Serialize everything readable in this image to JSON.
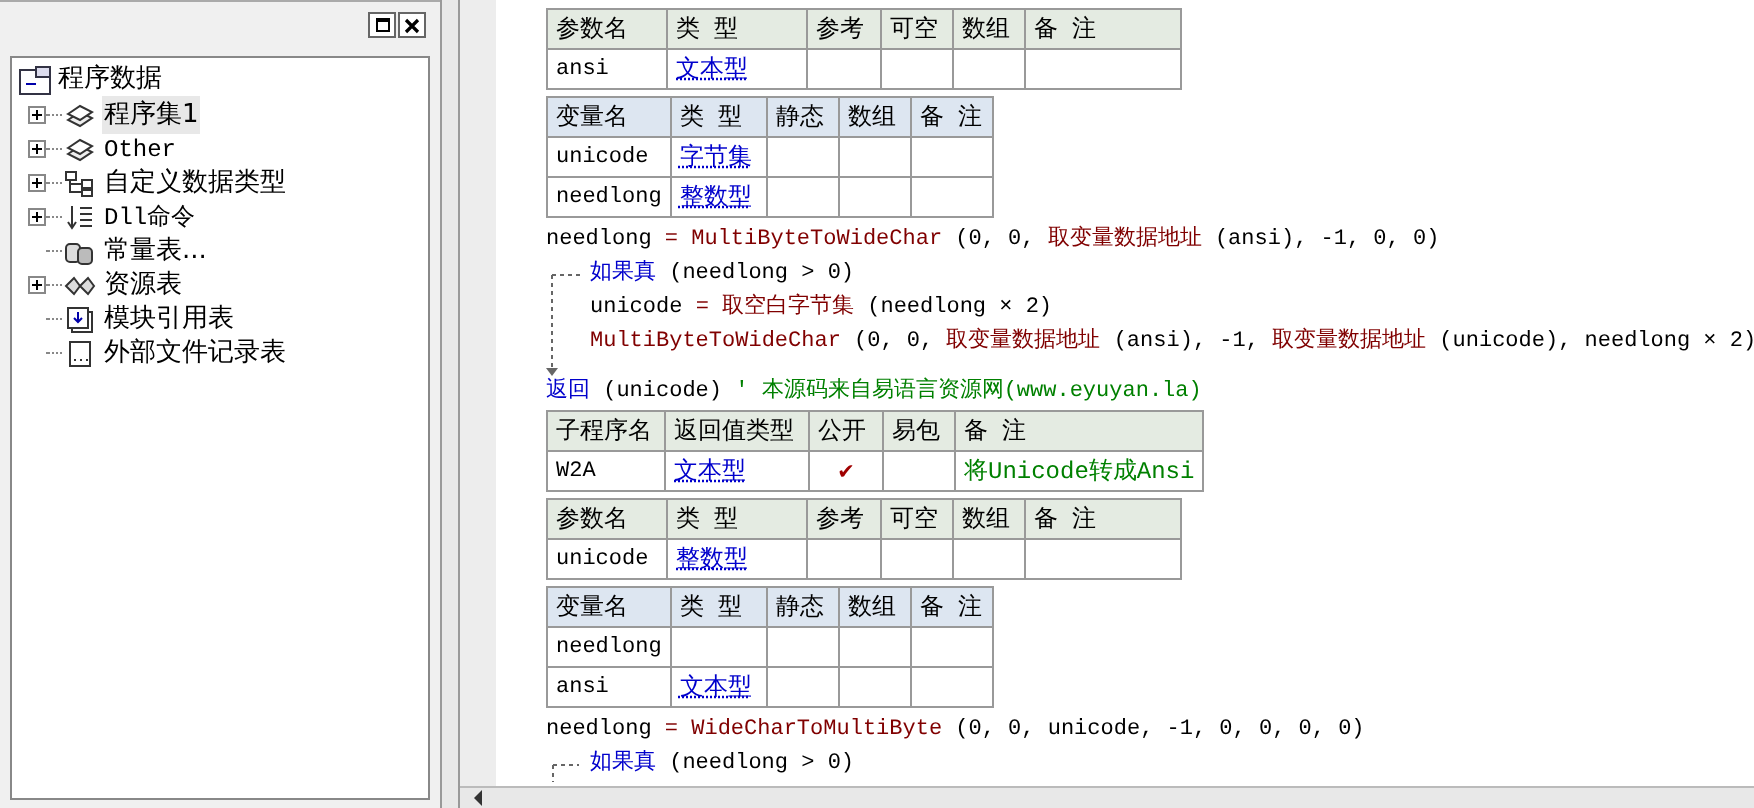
{
  "tree": {
    "root": "程序数据",
    "items": [
      {
        "label": "程序集1",
        "expandable": true,
        "selected": true
      },
      {
        "label": "Other",
        "expandable": true,
        "selected": false
      },
      {
        "label": "自定义数据类型",
        "expandable": true,
        "selected": false
      },
      {
        "label": "Dll命令",
        "expandable": true,
        "selected": false
      },
      {
        "label": "常量表...",
        "expandable": false,
        "selected": false
      },
      {
        "label": "资源表",
        "expandable": true,
        "selected": false
      },
      {
        "label": "模块引用表",
        "expandable": false,
        "selected": false
      },
      {
        "label": "外部文件记录表",
        "expandable": false,
        "selected": false
      }
    ]
  },
  "code": [
    {
      "kind": "param_table",
      "header": [
        "参数名",
        "类 型",
        "参考",
        "可空",
        "数组",
        "备 注"
      ],
      "rows": [
        [
          "ansi",
          "文本型",
          "",
          "",
          "",
          ""
        ]
      ]
    },
    {
      "kind": "var_table",
      "header": [
        "变量名",
        "类 型",
        "静态",
        "数组",
        "备 注"
      ],
      "rows": [
        [
          "unicode",
          "字节集",
          "",
          "",
          ""
        ],
        [
          "needlong",
          "整数型",
          "",
          "",
          ""
        ]
      ]
    },
    {
      "kind": "line",
      "tokens": [
        {
          "kind": "text",
          "text": "needlong "
        },
        {
          "kind": "func",
          "text": "= MultiByteToWideChar"
        },
        {
          "kind": "text",
          "text": " (0, 0, "
        },
        {
          "kind": "func",
          "text": "取变量数据地址"
        },
        {
          "kind": "text",
          "text": " (ansi), -1, 0, 0)"
        }
      ]
    },
    {
      "kind": "if",
      "condition": [
        {
          "kind": "keyword",
          "text": "如果真"
        },
        {
          "kind": "text",
          "text": " (needlong > 0)"
        }
      ],
      "children": [
        {
          "kind": "line",
          "tokens": [
            {
              "kind": "text",
              "text": "unicode "
            },
            {
              "kind": "func",
              "text": "= 取空白字节集"
            },
            {
              "kind": "text",
              "text": " (needlong × 2)"
            }
          ]
        },
        {
          "kind": "line",
          "tokens": [
            {
              "kind": "func",
              "text": "MultiByteToWideChar"
            },
            {
              "kind": "text",
              "text": " (0, 0, "
            },
            {
              "kind": "func",
              "text": "取变量数据地址"
            },
            {
              "kind": "text",
              "text": " (ansi), -1, "
            },
            {
              "kind": "func",
              "text": "取变量数据地址"
            },
            {
              "kind": "text",
              "text": " (unicode), needlong × 2)"
            }
          ]
        }
      ]
    },
    {
      "kind": "line",
      "tokens": [
        {
          "kind": "keyword",
          "text": "返回"
        },
        {
          "kind": "text",
          "text": " (unicode) "
        },
        {
          "kind": "comment",
          "text": "' 本源码来自易语言资源网(www.eyuyan.la)"
        }
      ]
    },
    {
      "kind": "sub_table",
      "header": [
        "子程序名",
        "返回值类型",
        "公开",
        "易包",
        "备 注"
      ],
      "rows": [
        [
          "W2A",
          "文本型",
          "✔",
          "",
          "将Unicode转成Ansi"
        ]
      ]
    },
    {
      "kind": "param_table",
      "header": [
        "参数名",
        "类 型",
        "参考",
        "可空",
        "数组",
        "备 注"
      ],
      "rows": [
        [
          "unicode",
          "整数型",
          "",
          "",
          "",
          ""
        ]
      ]
    },
    {
      "kind": "var_table",
      "header": [
        "变量名",
        "类 型",
        "静态",
        "数组",
        "备 注"
      ],
      "rows": [
        [
          "needlong",
          "",
          "",
          "",
          ""
        ],
        [
          "ansi",
          "文本型",
          "",
          "",
          ""
        ]
      ]
    },
    {
      "kind": "line",
      "tokens": [
        {
          "kind": "text",
          "text": "needlong "
        },
        {
          "kind": "func",
          "text": "= WideCharToMultiByte"
        },
        {
          "kind": "text",
          "text": " (0, 0, unicode, -1, 0, 0, 0, 0)"
        }
      ]
    },
    {
      "kind": "if",
      "condition": [
        {
          "kind": "keyword",
          "text": "如果真"
        },
        {
          "kind": "text",
          "text": " (needlong > 0)"
        }
      ]
    }
  ]
}
